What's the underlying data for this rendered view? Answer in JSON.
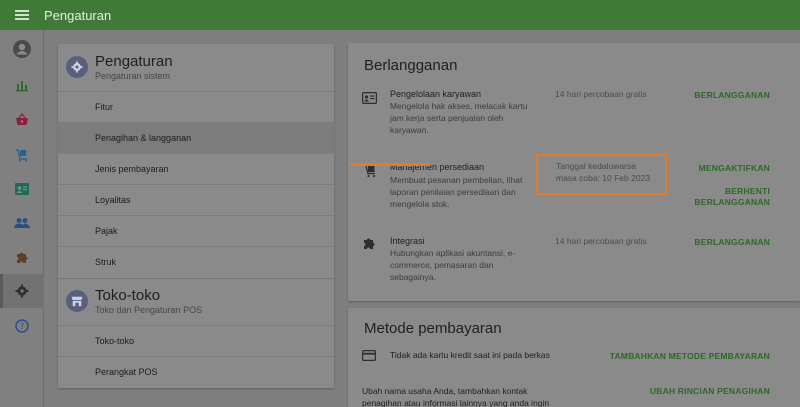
{
  "topbar": {
    "title": "Pengaturan"
  },
  "rail": {
    "items": [
      {
        "name": "account-icon"
      },
      {
        "name": "reports-icon"
      },
      {
        "name": "basket-icon"
      },
      {
        "name": "items-icon"
      },
      {
        "name": "employees-icon"
      },
      {
        "name": "customers-icon"
      },
      {
        "name": "integrations-icon"
      },
      {
        "name": "settings-icon"
      },
      {
        "name": "help-icon"
      }
    ]
  },
  "settings_nav": {
    "section1": {
      "title": "Pengaturan",
      "subtitle": "Pengaturan sistem",
      "items": [
        "Fitur",
        "Penagihan & langganan",
        "Jenis pembayaran",
        "Loyalitas",
        "Pajak",
        "Struk"
      ]
    },
    "section2": {
      "title": "Toko-toko",
      "subtitle": "Toko dan Pengaturan POS",
      "items": [
        "Toko-toko",
        "Perangkat POS"
      ]
    }
  },
  "subscriptions": {
    "title": "Berlangganan",
    "rows": [
      {
        "title": "Pengelolaan karyawan",
        "desc": "Mengelola hak akses, melacak kartu jam kerja serta penjualan oleh karyawan.",
        "status": "14 hari percobaan gratis",
        "action": "BERLANGGANAN"
      },
      {
        "title": "Manajemen persediaan",
        "desc": "Membuat pesanan pembelian, lihat laporan penilaian persediaan dan mengelola stok.",
        "status_line1": "Tanggal kedaluwarsa",
        "status_line2": "masa coba: 10 Feb 2023",
        "action": "MENGAKTIFKAN",
        "action2_line1": "BERHENTI",
        "action2_line2": "BERLANGGANAN"
      },
      {
        "title": "Integrasi",
        "desc": "Hubungkan aplikasi akuntansi, e-commerce, pemasaran dan sebagainya.",
        "status": "14 hari percobaan gratis",
        "action": "BERLANGGANAN"
      }
    ]
  },
  "payment": {
    "title": "Metode pembayaran",
    "no_card": "Tidak ada kartu kredit saat ini pada berkas",
    "add_action": "TAMBAHKAN METODE PEMBAYARAN",
    "billing_text": "Ubah nama usaha Anda, tambahkan kontak penagihan atau informasi lainnya yang anda ingin",
    "billing_action": "UBAH RINCIAN PENAGIHAN"
  },
  "colors": {
    "topbar": "#3f7a37",
    "action": "#2e6828",
    "highlight": "#e07d2a"
  }
}
